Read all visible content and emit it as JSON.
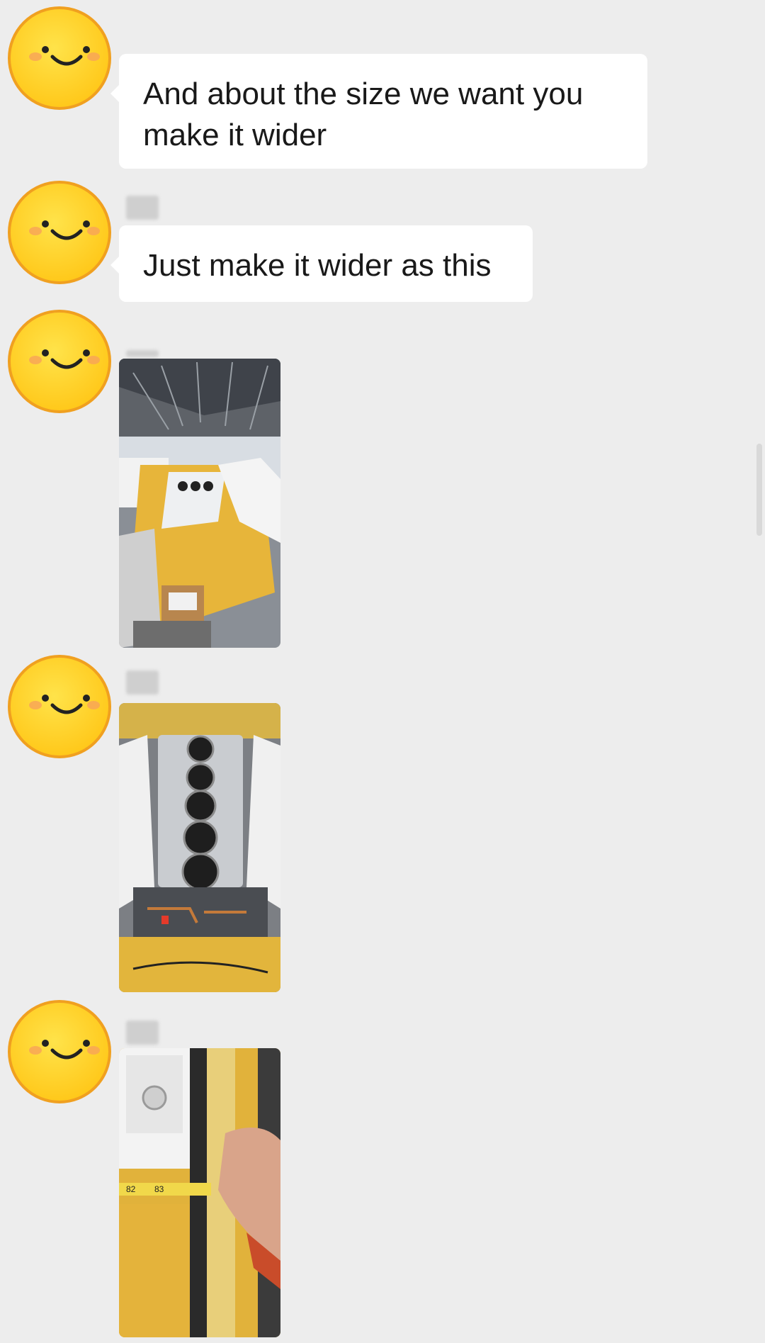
{
  "messages": [
    {
      "type": "text",
      "avatar": "smiley-face-avatar",
      "text": "And about the size we want you make it wider"
    },
    {
      "type": "text",
      "avatar": "smiley-face-avatar",
      "text": "Just make it wider as this"
    },
    {
      "type": "image",
      "avatar": "smiley-face-avatar",
      "image": "workshop-bus-roof-photo"
    },
    {
      "type": "image",
      "avatar": "smiley-face-avatar",
      "image": "ac-unit-fans-photo"
    },
    {
      "type": "image",
      "avatar": "smiley-face-avatar",
      "image": "tape-measure-photo",
      "measure_labels": [
        "82",
        "83"
      ]
    }
  ],
  "colors": {
    "background": "#ededed",
    "bubble": "#ffffff",
    "avatar_face": "#ffd21f",
    "avatar_outline": "#f0a020"
  }
}
